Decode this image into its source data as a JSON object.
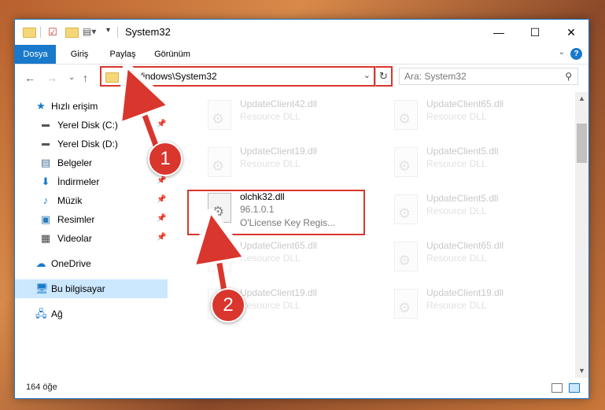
{
  "window": {
    "title": "System32"
  },
  "ribbon": {
    "tabs": [
      "Dosya",
      "Giriş",
      "Paylaş",
      "Görünüm"
    ],
    "help_label": "?"
  },
  "nav": {
    "address": "C:\\Windows\\System32",
    "search_placeholder": "Ara: System32"
  },
  "sidebar": {
    "items": [
      {
        "label": "Hızlı erişim",
        "icon": "star-icon"
      },
      {
        "label": "Yerel Disk (C:)",
        "icon": "drive-icon"
      },
      {
        "label": "Yerel Disk (D:)",
        "icon": "drive-icon"
      },
      {
        "label": "Belgeler",
        "icon": "documents-icon"
      },
      {
        "label": "İndirmeler",
        "icon": "download-icon"
      },
      {
        "label": "Müzik",
        "icon": "music-icon"
      },
      {
        "label": "Resimler",
        "icon": "pictures-icon"
      },
      {
        "label": "Videolar",
        "icon": "video-icon"
      },
      {
        "label": "OneDrive",
        "icon": "cloud-icon"
      },
      {
        "label": "Bu bilgisayar",
        "icon": "computer-icon"
      },
      {
        "label": "Ağ",
        "icon": "network-icon"
      }
    ]
  },
  "files": [
    {
      "name": "UpdateClient42.dll",
      "line1": "Resource DLL"
    },
    {
      "name": "UpdateClient65.dll",
      "line1": "Resource DLL"
    },
    {
      "name": "UpdateClient19.dll",
      "line1": "Resource DLL"
    },
    {
      "name": "UpdateClient5.dll",
      "line1": "Resource DLL"
    },
    {
      "name": "olchk32.dll",
      "line1": "96.1.0.1",
      "line2": "O'License Key Regis..."
    },
    {
      "name": "UpdateClient5.dll",
      "line1": "Resource DLL"
    },
    {
      "name": "UpdateClient65.dll",
      "line1": "Resource DLL"
    },
    {
      "name": "UpdateClient65.dll",
      "line1": "Resource DLL"
    },
    {
      "name": "UpdateClient19.dll",
      "line1": "Resource DLL"
    },
    {
      "name": "UpdateClient19.dll",
      "line1": "Resource DLL"
    }
  ],
  "status": {
    "count": "164 öğe"
  },
  "annotations": {
    "badge1": "1",
    "badge2": "2"
  },
  "colors": {
    "accent": "#1979ca",
    "highlight": "#d9362e",
    "selection": "#cce8ff"
  }
}
